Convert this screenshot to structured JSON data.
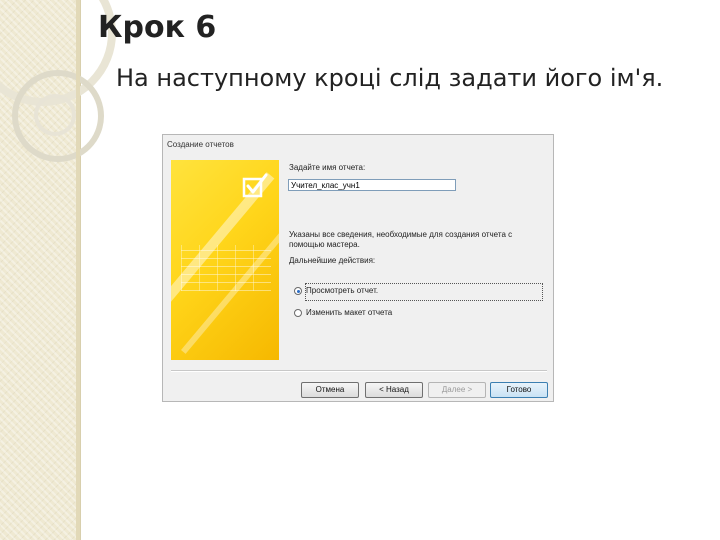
{
  "slide": {
    "title": "Крок 6",
    "body": "На наступному кроці слід задати його ім'я."
  },
  "dialog": {
    "title": "Создание отчетов",
    "field_label": "Задайте имя отчета:",
    "report_name_value": "Учител_клас_учн1",
    "info_text": "Указаны все сведения, необходимые для создания отчета с помощью мастера.",
    "next_actions_label": "Дальнейшие действия:",
    "options": [
      {
        "label": "Просмотреть отчет.",
        "selected": true
      },
      {
        "label": "Изменить макет отчета",
        "selected": false
      }
    ],
    "buttons": {
      "cancel": "Отмена",
      "back": "< Назад",
      "next": "Далее >",
      "finish": "Готово"
    }
  },
  "icons": {
    "wizard": "check-icon",
    "radio": "radio-button"
  },
  "colors": {
    "wizard_panel": "#ffd51a",
    "dialog_bg": "#f0f0f0",
    "finish_button": "#c9e2f4",
    "strip": "#efe9d2"
  }
}
